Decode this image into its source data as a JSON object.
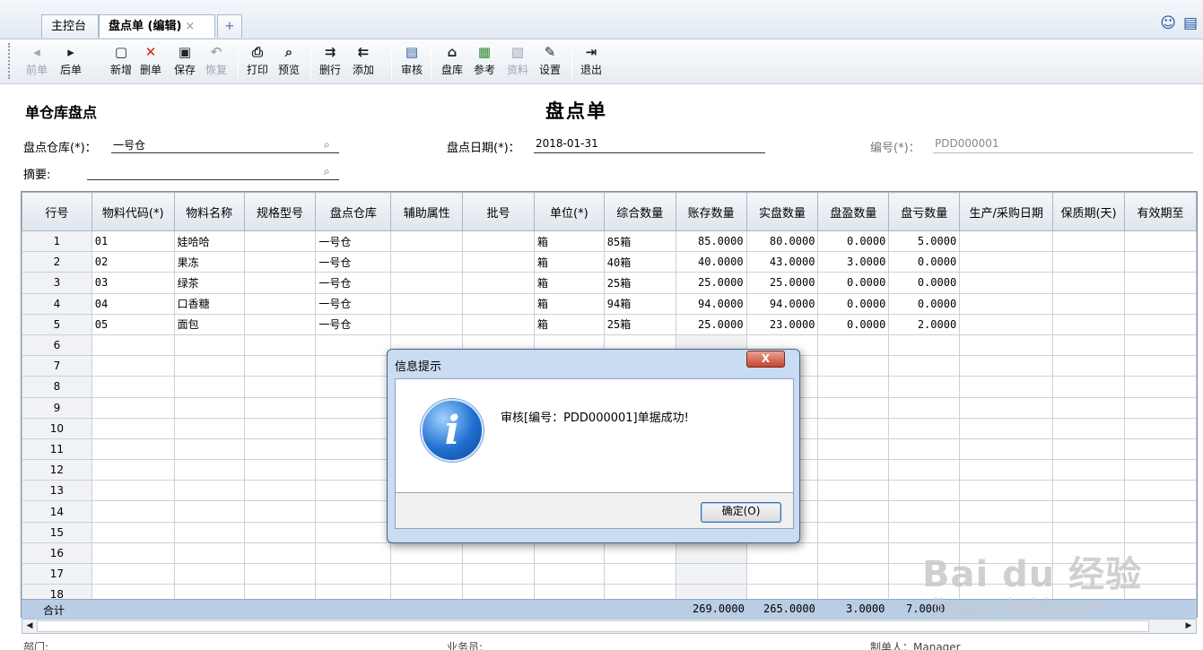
{
  "tabs": [
    {
      "label": "主控台"
    },
    {
      "label": "盘点单 (编辑)"
    }
  ],
  "tab_close": "×",
  "tab_add": "+",
  "top_icons": [
    "smile-icon",
    "chat-icon"
  ],
  "toolbar": {
    "prev": "前单",
    "next": "后单",
    "add": "新增",
    "delete": "删单",
    "save": "保存",
    "restore": "恢复",
    "print": "打印",
    "preview": "预览",
    "delete_row": "删行",
    "add_row": "添加",
    "audit": "审核",
    "inventory": "盘库",
    "reference": "参考",
    "material": "资料",
    "settings": "设置",
    "exit": "退出"
  },
  "form": {
    "left_title": "单仓库盘点",
    "title": "盘点单",
    "warehouse_label": "盘点仓库(*)：",
    "warehouse_value": "一号仓",
    "date_label": "盘点日期(*)：",
    "date_value": "2018-01-31",
    "number_label": "编号(*)：",
    "number_value": "PDD000001",
    "summary_label": "摘要:",
    "summary_value": ""
  },
  "grid": {
    "columns": [
      "行号",
      "物料代码(*)",
      "物料名称",
      "规格型号",
      "盘点仓库",
      "辅助属性",
      "批号",
      "单位(*)",
      "综合数量",
      "账存数量",
      "实盘数量",
      "盘盈数量",
      "盘亏数量",
      "生产/采购日期",
      "保质期(天)",
      "有效期至"
    ],
    "rows": [
      {
        "n": "1",
        "code": "01",
        "name": "娃哈哈",
        "spec": "",
        "wh": "一号仓",
        "aux": "",
        "batch": "",
        "unit": "箱",
        "mix": "85箱",
        "book": "85.0000",
        "actual": "80.0000",
        "gain": "0.0000",
        "loss": "5.0000"
      },
      {
        "n": "2",
        "code": "02",
        "name": "果冻",
        "spec": "",
        "wh": "一号仓",
        "aux": "",
        "batch": "",
        "unit": "箱",
        "mix": "40箱",
        "book": "40.0000",
        "actual": "43.0000",
        "gain": "3.0000",
        "loss": "0.0000"
      },
      {
        "n": "3",
        "code": "03",
        "name": "绿茶",
        "spec": "",
        "wh": "一号仓",
        "aux": "",
        "batch": "",
        "unit": "箱",
        "mix": "25箱",
        "book": "25.0000",
        "actual": "25.0000",
        "gain": "0.0000",
        "loss": "0.0000"
      },
      {
        "n": "4",
        "code": "04",
        "name": "口香糖",
        "spec": "",
        "wh": "一号仓",
        "aux": "",
        "batch": "",
        "unit": "箱",
        "mix": "94箱",
        "book": "94.0000",
        "actual": "94.0000",
        "gain": "0.0000",
        "loss": "0.0000"
      },
      {
        "n": "5",
        "code": "05",
        "name": "面包",
        "spec": "",
        "wh": "一号仓",
        "aux": "",
        "batch": "",
        "unit": "箱",
        "mix": "25箱",
        "book": "25.0000",
        "actual": "23.0000",
        "gain": "0.0000",
        "loss": "2.0000"
      }
    ],
    "empty_rows": [
      "6",
      "7",
      "8",
      "9",
      "10",
      "11",
      "12",
      "13",
      "14",
      "15",
      "16",
      "17",
      "18"
    ],
    "total_label": "合计",
    "total_book": "269.0000",
    "total_actual": "265.0000",
    "total_gain": "3.0000",
    "total_loss": "7.0000"
  },
  "footer": {
    "dept": "部门:",
    "clerk": "业务员:",
    "maker": "制单人：Manager"
  },
  "dialog": {
    "title": "信息提示",
    "close": "X",
    "message": "审核[编号：PDD000001]单据成功!",
    "ok": "确定(O)"
  },
  "watermark": {
    "big": "Bai du 经验",
    "small": "jingyan.baidu.com"
  }
}
